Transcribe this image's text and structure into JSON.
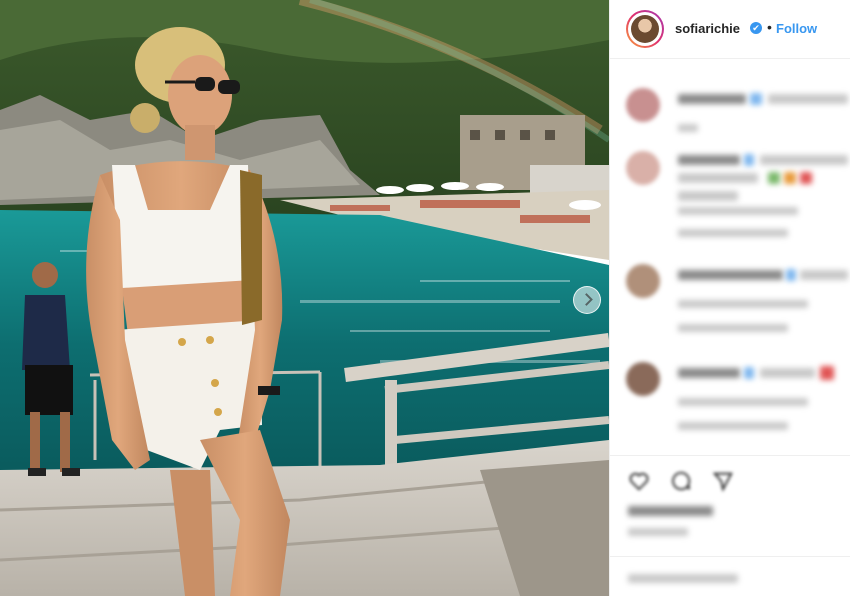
{
  "post": {
    "username": "sofiarichie",
    "verified_mark": "✔",
    "separator": "•",
    "follow_label": "Follow"
  },
  "icons": {
    "verified": "verified-badge-icon",
    "carousel_next": "chevron-right-icon",
    "like": "heart-icon",
    "comment": "comment-icon",
    "share": "share-icon"
  },
  "colors": {
    "accent": "#3897f0",
    "text": "#262626",
    "divider": "#efefef"
  }
}
